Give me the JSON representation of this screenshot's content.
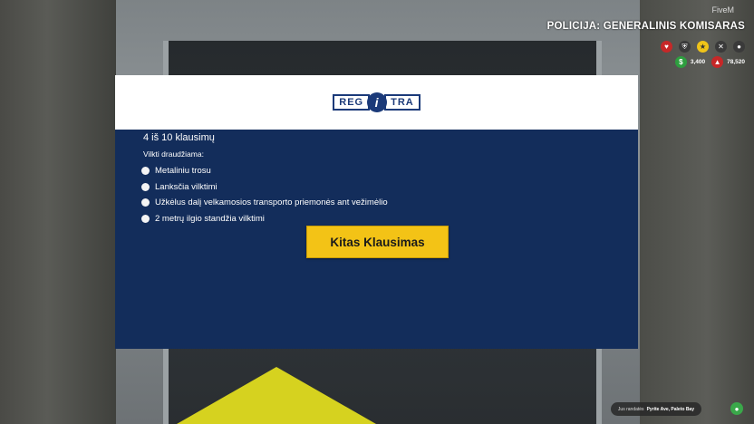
{
  "hud": {
    "fivem_label": "FiveM",
    "job_title": "POLICIJA: GENERALINIS KOMISARAS",
    "cash": "3,400",
    "bank": "78,520",
    "colors": {
      "health": "#c62828",
      "money": "#2e9e3f",
      "bank": "#c62828",
      "accent": "#f0c419"
    }
  },
  "panel": {
    "logo": {
      "left": "REG",
      "mid": "i",
      "right": "TRA"
    },
    "question_count": "4 iš 10 klausimų",
    "question_text": "Vilkti draudžiama:",
    "options": [
      "Metaliniu trosu",
      "Lanksčia vilktimi",
      "Užkėlus dalį velkamosios transporto priemonės ant vežimėlio",
      "2 metrų ilgio standžia vilktimi"
    ],
    "next_button": "Kitas Klausimas",
    "colors": {
      "panel_bg": "#132d5b",
      "header_bg": "#ffffff",
      "button_bg": "#f3c316"
    }
  },
  "footer": {
    "location_prefix": "Jus randatės",
    "location_name": "Pyrite Ave, Paleto Bay"
  }
}
